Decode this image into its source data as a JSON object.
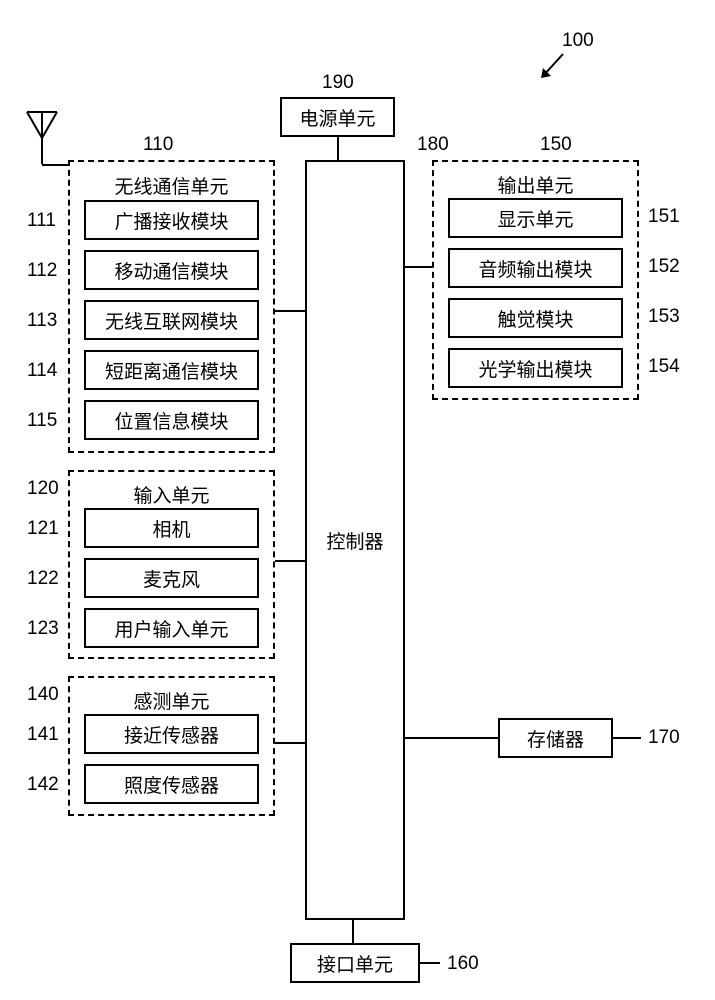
{
  "refs": {
    "device": "100",
    "power": "190",
    "controller": "180",
    "wireless": "110",
    "wbroadcast": "111",
    "wmobile": "112",
    "winternet": "113",
    "wshort": "114",
    "wloc": "115",
    "input": "120",
    "icamera": "121",
    "imic": "122",
    "iuser": "123",
    "sensing": "140",
    "sprox": "141",
    "sillum": "142",
    "output": "150",
    "odisplay": "151",
    "oaudio": "152",
    "ohaptic": "153",
    "ooptical": "154",
    "memory": "170",
    "interface": "160"
  },
  "labels": {
    "power": "电源单元",
    "controller": "控制器",
    "wireless": "无线通信单元",
    "wbroadcast": "广播接收模块",
    "wmobile": "移动通信模块",
    "winternet": "无线互联网模块",
    "wshort": "短距离通信模块",
    "wloc": "位置信息模块",
    "input": "输入单元",
    "icamera": "相机",
    "imic": "麦克风",
    "iuser": "用户输入单元",
    "sensing": "感测单元",
    "sprox": "接近传感器",
    "sillum": "照度传感器",
    "output": "输出单元",
    "odisplay": "显示单元",
    "oaudio": "音频输出模块",
    "ohaptic": "触觉模块",
    "ooptical": "光学输出模块",
    "memory": "存储器",
    "interface": "接口单元"
  }
}
